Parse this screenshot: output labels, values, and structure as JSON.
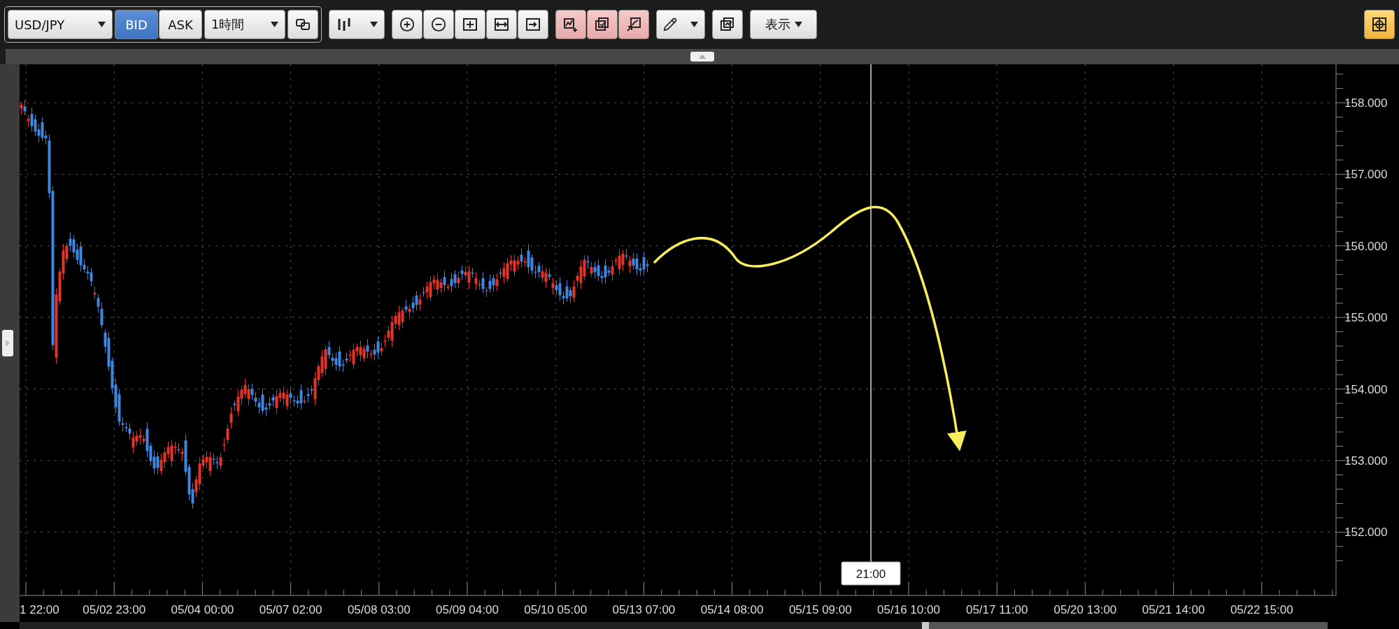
{
  "toolbar": {
    "symbol": "USD/JPY",
    "price_tabs": [
      {
        "label": "BID",
        "selected": true
      },
      {
        "label": "ASK",
        "selected": false
      }
    ],
    "timeframe": "1時間",
    "view_menu": "表示"
  },
  "chart": {
    "y_axis_labels": [
      "158.000",
      "157.000",
      "156.000",
      "155.000",
      "154.000",
      "153.000",
      "152.000"
    ],
    "x_axis_labels": [
      "1 22:00",
      "05/02 23:00",
      "05/04 00:00",
      "05/07 02:00",
      "05/08 03:00",
      "05/09 04:00",
      "05/10 05:00",
      "05/13 07:00",
      "05/14 08:00",
      "05/15 09:00",
      "05/16 10:00",
      "05/17 11:00",
      "05/20 13:00",
      "05/21 14:00",
      "05/22 15:00"
    ],
    "crosshair_label": "21:00"
  }
}
